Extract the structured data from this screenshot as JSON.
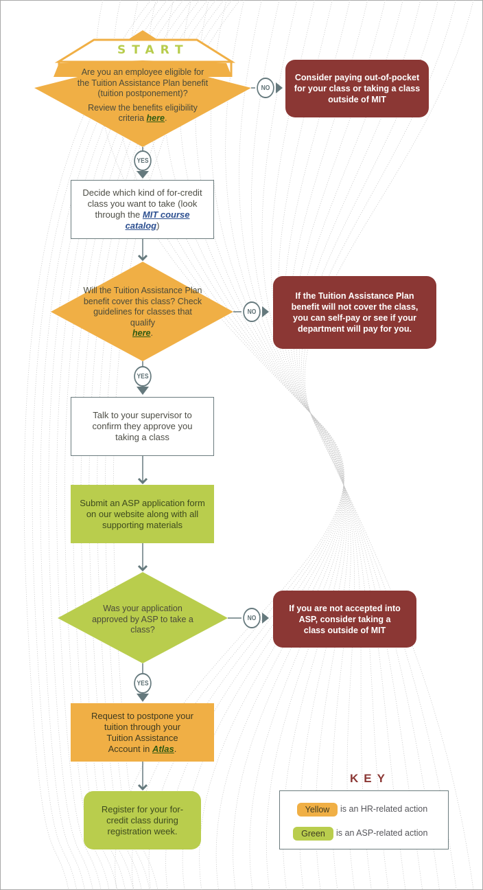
{
  "start_label": "START",
  "colors": {
    "yellow": "#f0af45",
    "green": "#b9cd4d",
    "red": "#8b3734",
    "connector": "#65797d"
  },
  "steps": {
    "q1": {
      "line1": "Are you an employee eligible for",
      "line2": "the Tuition Assistance Plan benefit",
      "line3": "(tuition postponement)?",
      "line4": "Review the benefits eligibility",
      "line5_prefix": "criteria ",
      "link": "here",
      "suffix": "."
    },
    "q1_no": "Consider paying out-of-pocket for your class or taking a class outside of MIT",
    "decide": {
      "prefix": "Decide which kind of for-credit class you want to take (look through the ",
      "link": "MIT course catalog",
      "suffix": ")"
    },
    "q2": {
      "text": "Will the Tuition Assistance Plan benefit cover this class? Check guidelines for classes that qualify",
      "link": "here",
      "suffix": "."
    },
    "q2_no": "If the Tuition Assistance Plan benefit will not cover the class, you can self-pay or see if your department will pay for you.",
    "supervisor": "Talk to your supervisor to confirm they approve you taking a class",
    "submit": "Submit an ASP application form on our website along with all supporting materials",
    "q3": "Was your application approved by ASP to take a class?",
    "q3_no": "If you are not accepted into ASP, consider taking a class outside of MIT",
    "request": {
      "prefix": "Request to postpone your tuition through your Tuition Assistance Account in ",
      "link": "Atlas",
      "suffix": "."
    },
    "register": "Register for your for-credit class during registration week."
  },
  "badges": {
    "yes": "YES",
    "no": "NO"
  },
  "key": {
    "title": "KEY",
    "items": [
      {
        "label": "Yellow",
        "desc": "is an HR-related action"
      },
      {
        "label": "Green",
        "desc": "is an ASP-related action"
      }
    ]
  }
}
